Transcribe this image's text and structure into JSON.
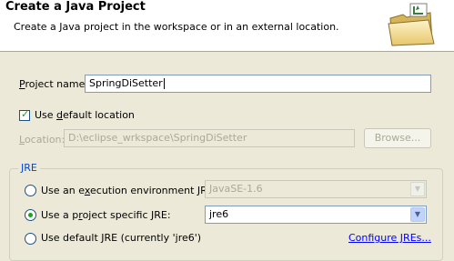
{
  "header": {
    "title": "Create a Java Project",
    "description": "Create a Java project in the workspace or in an external location.",
    "icon": "java-project-folder-icon"
  },
  "project": {
    "name_label_prefix": "",
    "name_label_mnemonic": "P",
    "name_label_rest": "roject name:",
    "name_value": "SpringDiSetter"
  },
  "location": {
    "checkbox_prefix": "Use ",
    "checkbox_mnemonic": "d",
    "checkbox_rest": "efault location",
    "checked": true,
    "label_mnemonic": "L",
    "label_rest": "ocation:",
    "value": "D:\\eclipse_wrkspace\\SpringDiSetter",
    "browse_label": "Browse..."
  },
  "jre": {
    "group_title": "JRE",
    "option_env_prefix": "Use an e",
    "option_env_mnemonic": "x",
    "option_env_rest": "ecution environment JRE:",
    "env_value": "JavaSE-1.6",
    "option_specific_prefix": "Use a p",
    "option_specific_mnemonic": "r",
    "option_specific_rest": "oject specific JRE:",
    "specific_value": "jre6",
    "option_default_prefix": "Use default JRE (currently 'jre6')",
    "configure_link": "Configure JREs..."
  },
  "colors": {
    "group_title": "#0046d5",
    "link": "#0000ff"
  }
}
